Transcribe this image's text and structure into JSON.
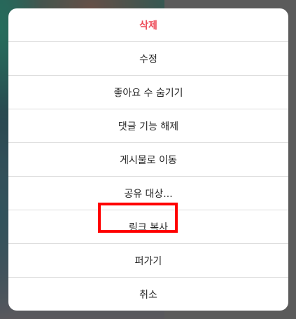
{
  "menu": {
    "items": [
      {
        "label": "삭제",
        "style": "danger"
      },
      {
        "label": "수정",
        "style": "normal"
      },
      {
        "label": "좋아요 수 숨기기",
        "style": "normal"
      },
      {
        "label": "댓글 기능 해제",
        "style": "normal"
      },
      {
        "label": "게시물로 이동",
        "style": "normal"
      },
      {
        "label": "공유 대상...",
        "style": "normal"
      },
      {
        "label": "링크 복사",
        "style": "normal"
      },
      {
        "label": "퍼가기",
        "style": "normal"
      },
      {
        "label": "취소",
        "style": "normal"
      }
    ]
  },
  "colors": {
    "danger": "#ed4956",
    "text": "#262626",
    "divider": "#dbdbdb",
    "highlight": "#ff0000",
    "overlay": "#5b5b5b"
  }
}
